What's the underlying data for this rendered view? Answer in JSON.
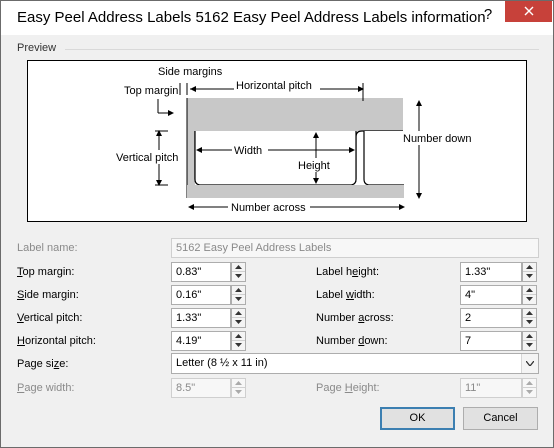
{
  "window": {
    "title": "Easy Peel Address Labels 5162 Easy Peel Address Labels information",
    "help_label": "?",
    "close_icon": "close-icon"
  },
  "preview": {
    "group_label": "Preview",
    "side_margins": "Side margins",
    "horizontal_pitch": "Horizontal pitch",
    "top_margin": "Top margin",
    "vertical_pitch": "Vertical pitch",
    "width": "Width",
    "height": "Height",
    "number_down": "Number down",
    "number_across": "Number across",
    "label_fill_color": "#c8c8c8"
  },
  "form": {
    "label_name": {
      "label": "Label name:",
      "value": "5162 Easy Peel Address Labels"
    },
    "top_margin": {
      "label_prefix": "",
      "label_key": "T",
      "label_rest": "op margin:",
      "value": "0.83\""
    },
    "side_margin": {
      "label_prefix": "",
      "label_key": "S",
      "label_rest": "ide margin:",
      "value": "0.16\""
    },
    "vertical_pitch": {
      "label_prefix": "",
      "label_key": "V",
      "label_rest": "ertical pitch:",
      "value": "1.33\""
    },
    "horizontal_pitch": {
      "label_prefix": "",
      "label_key": "H",
      "label_rest": "orizontal pitch:",
      "value": "4.19\""
    },
    "page_size": {
      "label_prefix": "Page si",
      "label_key": "z",
      "label_rest": "e:",
      "value": "Letter (8 ½ x 11 in)"
    },
    "page_width": {
      "label_prefix": "",
      "label_key": "P",
      "label_rest": "age width:",
      "value": "8.5\""
    },
    "label_height": {
      "label_prefix": "Label h",
      "label_key": "e",
      "label_rest": "ight:",
      "value": "1.33\""
    },
    "label_width": {
      "label_prefix": "Label ",
      "label_key": "w",
      "label_rest": "idth:",
      "value": "4\""
    },
    "number_across": {
      "label_prefix": "Number ",
      "label_key": "a",
      "label_rest": "cross:",
      "value": "2"
    },
    "number_down": {
      "label_prefix": "Number ",
      "label_key": "d",
      "label_rest": "own:",
      "value": "7"
    },
    "page_height": {
      "label_prefix": "Page ",
      "label_key": "H",
      "label_rest": "eight:",
      "value": "11\""
    }
  },
  "buttons": {
    "ok": "OK",
    "cancel": "Cancel"
  },
  "icons": {
    "spin_up": "spin-up-icon",
    "spin_down": "spin-down-icon",
    "dropdown": "chevron-down-icon"
  },
  "colors": {
    "close_button": "#c7413a",
    "default_button_border": "#3c7fb1",
    "disabled_text": "#8a8a8a"
  }
}
